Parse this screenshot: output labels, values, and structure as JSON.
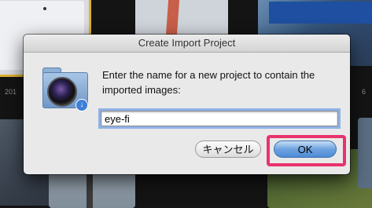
{
  "background": {
    "year_label": "201",
    "count_label": "6"
  },
  "dialog": {
    "title": "Create Import Project",
    "message": "Enter the name for a new project to contain the imported images:",
    "input_value": "eye-fi",
    "cancel_label": "キャンセル",
    "ok_label": "OK",
    "icon": "camera-folder-icon"
  },
  "colors": {
    "highlight": "#e8336d",
    "ok_button": "#6fa3e0"
  }
}
